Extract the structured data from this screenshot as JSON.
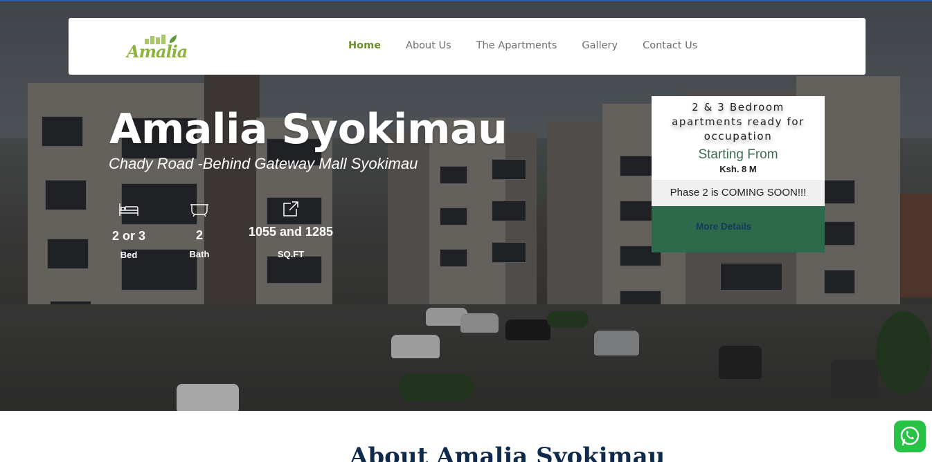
{
  "navbar": {
    "logo_text": "Amalia",
    "links": [
      {
        "label": "Home",
        "active": true
      },
      {
        "label": "About Us",
        "active": false
      },
      {
        "label": "The Apartments",
        "active": false
      },
      {
        "label": "Gallery",
        "active": false
      },
      {
        "label": "Contact Us",
        "active": false
      }
    ]
  },
  "hero": {
    "title": "Amalia Syokimau",
    "subtitle": "Chady Road -Behind Gateway Mall Syokimau",
    "features": [
      {
        "icon": "bed-icon",
        "value": "2 or 3",
        "label": "Bed"
      },
      {
        "icon": "bathtub-icon",
        "value": "2",
        "label": "Bath"
      },
      {
        "icon": "expand-icon",
        "value": "1055 and 1285",
        "label": "SQ.FT"
      }
    ]
  },
  "card": {
    "headline": "2 & 3 Bedroom apartments ready for occupation",
    "starting_label": "Starting From",
    "price": "Ksh. 8 M",
    "phase_note": "Phase 2 is COMING SOON!!!",
    "more_label": "More Details"
  },
  "about": {
    "title": "About Amalia Syokimau"
  },
  "colors": {
    "accent_green": "#6a8f2b",
    "card_green": "#2d6a4b",
    "heading_navy": "#0f2a4a",
    "whatsapp": "#28c246"
  }
}
